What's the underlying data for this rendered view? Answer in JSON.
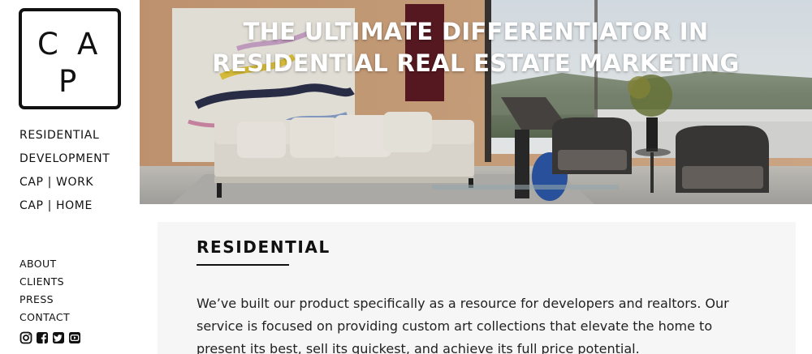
{
  "logo": {
    "letters": [
      "C",
      "A",
      "P"
    ]
  },
  "nav": {
    "main": [
      "RESIDENTIAL",
      "DEVELOPMENT",
      "CAP | WORK",
      "CAP | HOME"
    ],
    "secondary": [
      "ABOUT",
      "CLIENTS",
      "PRESS",
      "CONTACT"
    ]
  },
  "social": [
    "instagram-icon",
    "facebook-icon",
    "twitter-icon",
    "youtube-icon"
  ],
  "hero": {
    "title_line1": "THE ULTIMATE DIFFERENTIATOR IN",
    "title_line2": "RESIDENTIAL REAL ESTATE MARKETING"
  },
  "section": {
    "heading": "RESIDENTIAL",
    "body": "We’ve built our product specifically as a resource for developers and realtors. Our service is focused on providing custom art collections that elevate the home to present its best, sell its quickest, and achieve its full price potential."
  },
  "colors": {
    "text": "#111111",
    "card_bg": "#f6f6f6",
    "hero_text": "#ffffff"
  }
}
